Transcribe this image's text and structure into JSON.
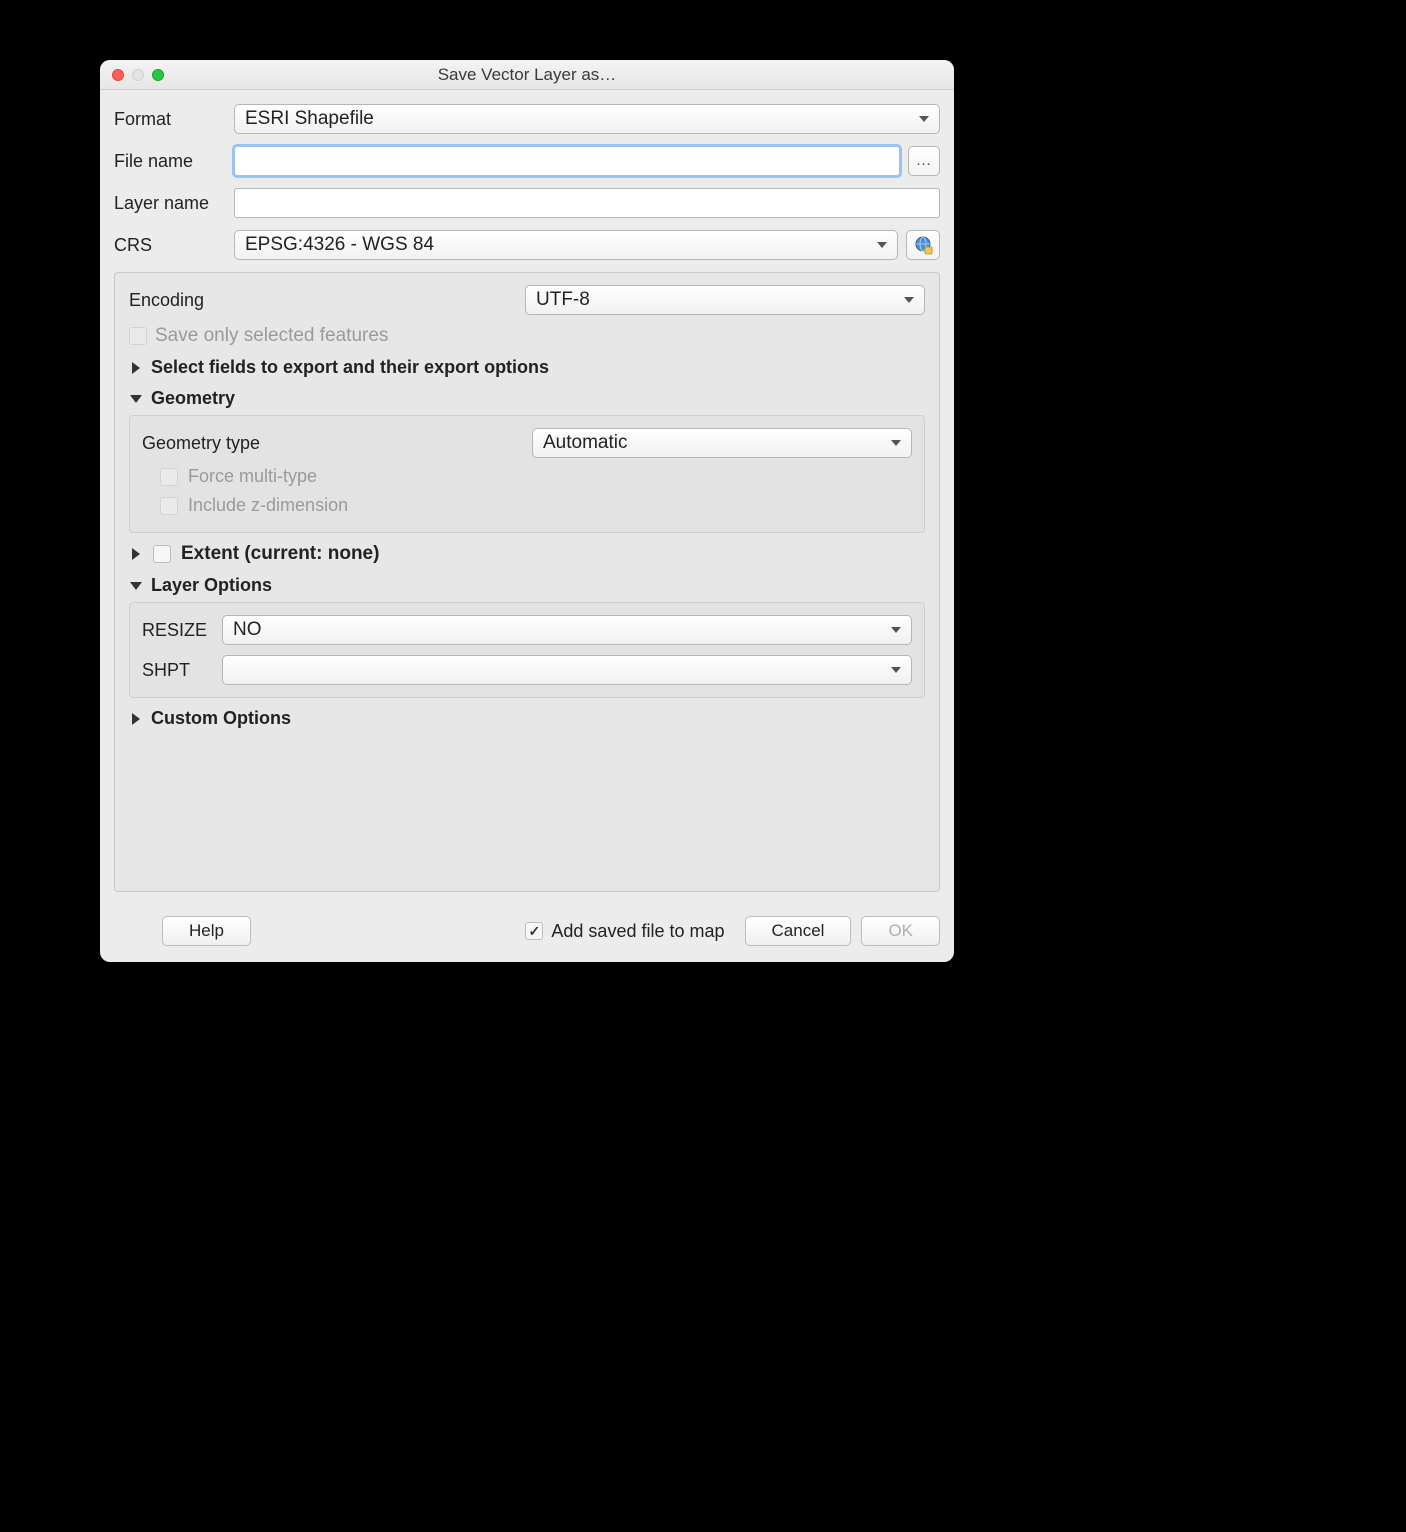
{
  "title": "Save Vector Layer as…",
  "labels": {
    "format": "Format",
    "file_name": "File name",
    "layer_name": "Layer name",
    "crs": "CRS",
    "encoding": "Encoding",
    "save_selected": "Save only selected features",
    "select_fields": "Select fields to export and their export options",
    "geometry": "Geometry",
    "geometry_type": "Geometry type",
    "force_multi": "Force multi-type",
    "include_z": "Include z-dimension",
    "extent": "Extent (current: none)",
    "layer_options": "Layer Options",
    "resize": "RESIZE",
    "shpt": "SHPT",
    "custom_options": "Custom Options",
    "add_saved": "Add saved file to map",
    "help": "Help",
    "cancel": "Cancel",
    "ok": "OK",
    "browse": "…"
  },
  "values": {
    "format": "ESRI Shapefile",
    "file_name": "",
    "layer_name": "",
    "crs": "EPSG:4326 - WGS 84",
    "encoding": "UTF-8",
    "geometry_type": "Automatic",
    "resize": "NO",
    "shpt": ""
  },
  "state": {
    "add_saved_checked": true,
    "ok_enabled": false,
    "save_selected_enabled": false,
    "force_multi_enabled": false,
    "include_z_enabled": false
  }
}
